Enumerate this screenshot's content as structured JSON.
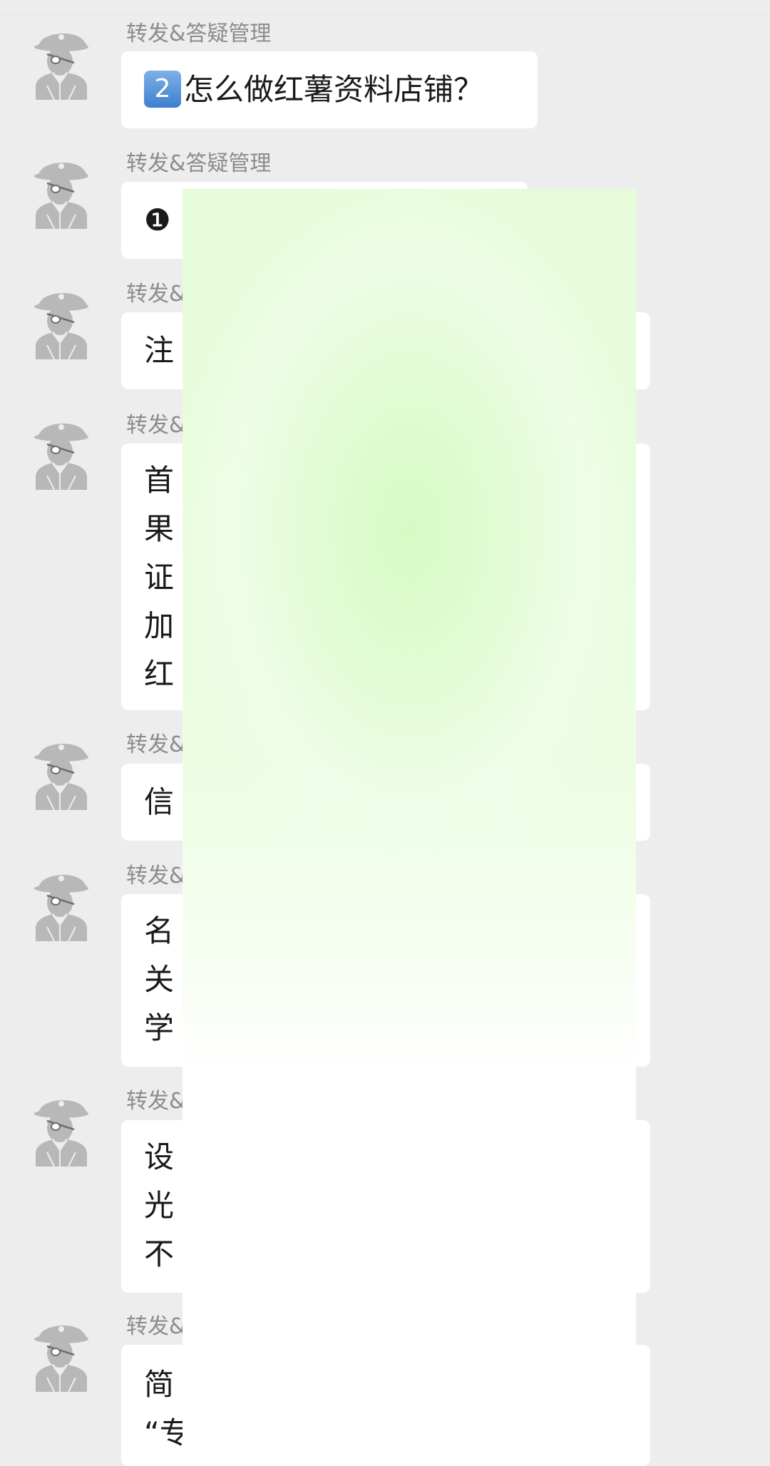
{
  "chat": {
    "messages": [
      {
        "sender": "转发&答疑管理",
        "badge": "2",
        "lines": [
          "怎么做红薯资料店铺？"
        ]
      },
      {
        "sender": "转发&答疑管理",
        "badge": "❶",
        "lines": [
          "  ⁠"
        ]
      },
      {
        "sender": "转发&",
        "lines": [
          "注"
        ]
      },
      {
        "sender": "转发&",
        "lines": [
          "首",
          "果",
          "证",
          "加",
          "红"
        ]
      },
      {
        "sender": "转发&",
        "lines": [
          "信"
        ]
      },
      {
        "sender": "转发&",
        "lines": [
          "名",
          "关",
          "学"
        ]
      },
      {
        "sender": "转发&",
        "lines": [
          "设",
          "光",
          "不"
        ]
      },
      {
        "sender": "转发&",
        "lines": [
          "简",
          "“专"
        ]
      }
    ]
  },
  "colors": {
    "background": "#ededed",
    "bubble": "#ffffff",
    "sender_text": "#8c8c8c",
    "overlay": "#e3fbd5"
  },
  "icons": {
    "avatar": "pirate-avatar-icon"
  }
}
